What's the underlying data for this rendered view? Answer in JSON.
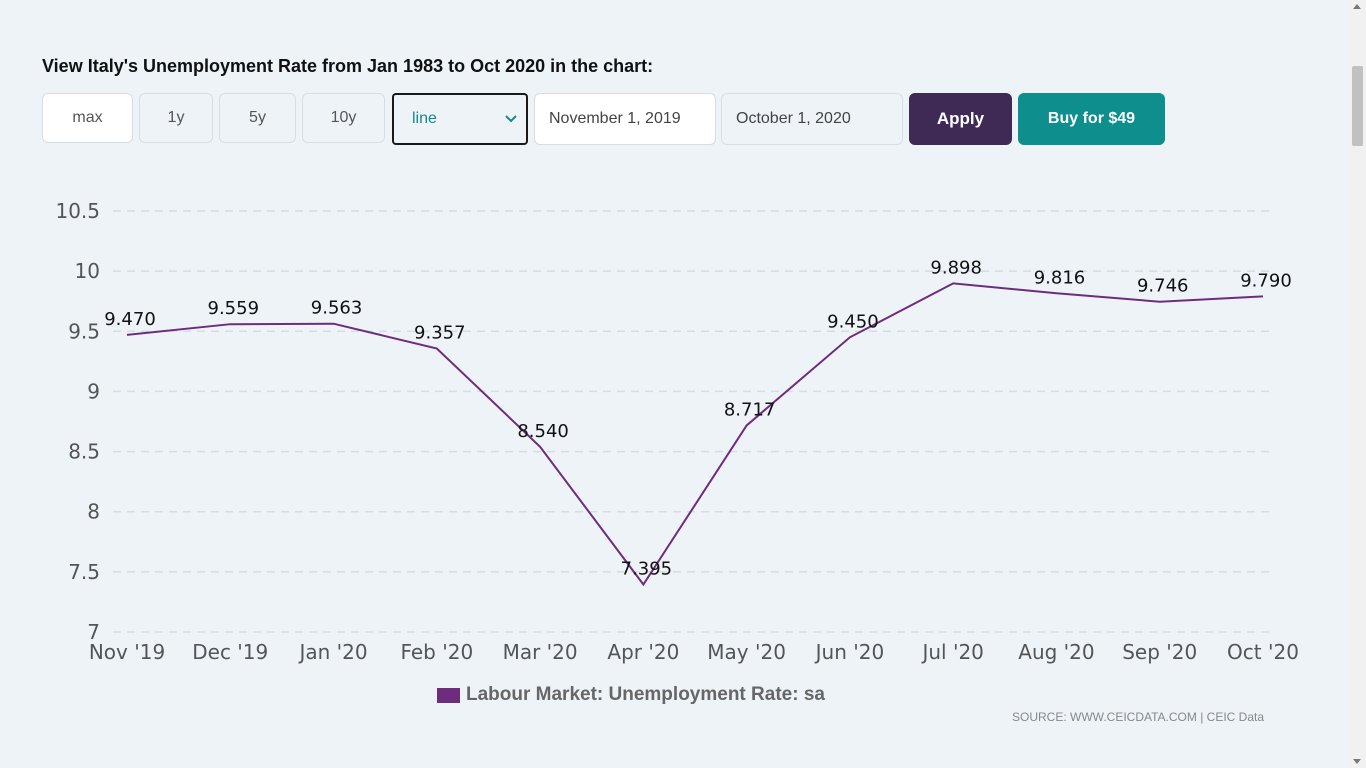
{
  "heading": "View Italy's Unemployment Rate from Jan 1983 to Oct 2020 in the chart:",
  "controls": {
    "range_buttons": [
      "max",
      "1y",
      "5y",
      "10y"
    ],
    "chart_type_selected": "line",
    "start_date": "November 1, 2019",
    "end_date": "October 1, 2020",
    "apply_label": "Apply",
    "buy_label": "Buy for $49"
  },
  "colors": {
    "series": "#6e2c7c",
    "apply_bg": "#3f2a56",
    "buy_bg": "#0f8e8e",
    "select_text": "#17888a"
  },
  "chart_data": {
    "type": "line",
    "x": [
      "Nov '19",
      "Dec '19",
      "Jan '20",
      "Feb '20",
      "Mar '20",
      "Apr '20",
      "May '20",
      "Jun '20",
      "Jul '20",
      "Aug '20",
      "Sep '20",
      "Oct '20"
    ],
    "series": [
      {
        "name": "Labour Market: Unemployment Rate: sa",
        "values": [
          9.47,
          9.559,
          9.563,
          9.357,
          8.54,
          7.395,
          8.717,
          9.45,
          9.898,
          9.816,
          9.746,
          9.79
        ],
        "labels": [
          "9.470",
          "9.559",
          "9.563",
          "9.357",
          "8.540",
          "7.395",
          "8.717",
          "9.450",
          "9.898",
          "9.816",
          "9.746",
          "9.790"
        ]
      }
    ],
    "y_ticks": [
      "7",
      "7.5",
      "8",
      "8.5",
      "9",
      "9.5",
      "10",
      "10.5"
    ],
    "y_tick_values": [
      7,
      7.5,
      8,
      8.5,
      9,
      9.5,
      10,
      10.5
    ],
    "ylim": [
      7,
      10.5
    ],
    "grid": "horizontal-dashed",
    "legend_position": "bottom-center"
  },
  "legend": {
    "label": "Labour Market: Unemployment Rate: sa"
  },
  "source": "SOURCE: WWW.CEICDATA.COM | CEIC Data"
}
